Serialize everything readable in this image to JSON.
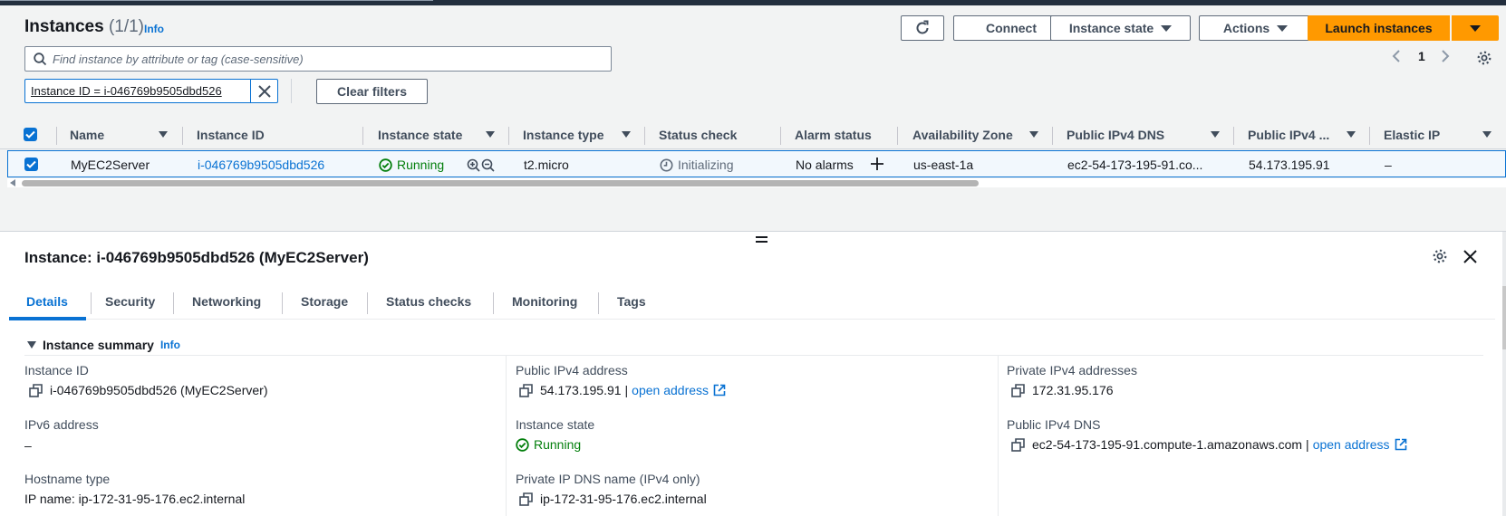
{
  "header": {
    "title": "Instances",
    "count": "(1/1)",
    "info": "Info",
    "connect": "Connect",
    "instance_state": "Instance state",
    "actions": "Actions",
    "launch": "Launch instances"
  },
  "search": {
    "placeholder": "Find instance by attribute or tag (case-sensitive)"
  },
  "pagination": {
    "page": "1"
  },
  "filter": {
    "chip": "Instance ID = i-046769b9505dbd526",
    "clear": "Clear filters"
  },
  "table": {
    "columns": [
      "Name",
      "Instance ID",
      "Instance state",
      "Instance type",
      "Status check",
      "Alarm status",
      "Availability Zone",
      "Public IPv4 DNS",
      "Public IPv4 ...",
      "Elastic IP"
    ],
    "row": {
      "name": "MyEC2Server",
      "instance_id": "i-046769b9505dbd526",
      "state": "Running",
      "type": "t2.micro",
      "status_check": "Initializing",
      "alarm": "No alarms",
      "az": "us-east-1a",
      "dns": "ec2-54-173-195-91.co...",
      "ipv4": "54.173.195.91",
      "elastic_ip": "–"
    }
  },
  "details": {
    "title": "Instance: i-046769b9505dbd526 (MyEC2Server)",
    "tabs": [
      "Details",
      "Security",
      "Networking",
      "Storage",
      "Status checks",
      "Monitoring",
      "Tags"
    ],
    "summary_title": "Instance summary",
    "summary_info": "Info",
    "fields": {
      "instance_id_label": "Instance ID",
      "instance_id_value": "i-046769b9505dbd526 (MyEC2Server)",
      "ipv6_label": "IPv6 address",
      "ipv6_value": "–",
      "hostname_label": "Hostname type",
      "hostname_value": "IP name: ip-172-31-95-176.ec2.internal",
      "pub_ip_label": "Public IPv4 address",
      "pub_ip_value": "54.173.195.91",
      "open_address": "open address",
      "state_label": "Instance state",
      "state_value": "Running",
      "priv_dns_label": "Private IP DNS name (IPv4 only)",
      "priv_dns_value": "ip-172-31-95-176.ec2.internal",
      "priv_ip_label": "Private IPv4 addresses",
      "priv_ip_value": "172.31.95.176",
      "pub_dns_label": "Public IPv4 DNS",
      "pub_dns_value": "ec2-54-173-195-91.compute-1.amazonaws.com",
      "pipe": "|"
    }
  },
  "colors": {
    "accent": "#0972d3",
    "launch": "#ff9900",
    "running": "#037f0c"
  }
}
